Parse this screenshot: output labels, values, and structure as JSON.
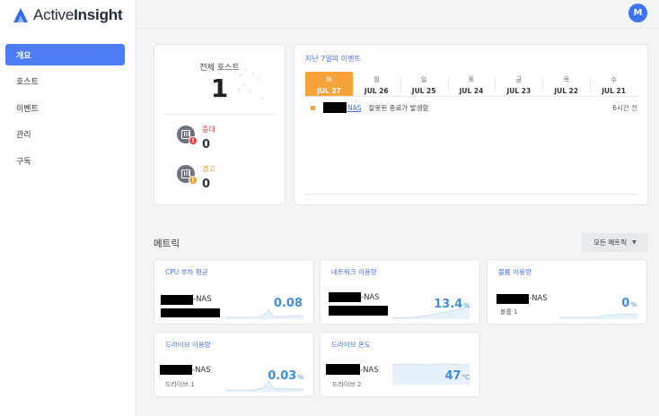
{
  "app": {
    "brand_light": "Active",
    "brand_bold": "Insight",
    "user_initial": "M"
  },
  "sidebar": {
    "items": [
      {
        "label": "개요",
        "active": true
      },
      {
        "label": "호스트",
        "active": false
      },
      {
        "label": "이벤트",
        "active": false
      },
      {
        "label": "관리",
        "active": false
      },
      {
        "label": "구독",
        "active": false
      }
    ]
  },
  "hosts": {
    "title": "전체 호스트",
    "count": "1",
    "critical": {
      "label": "중대",
      "value": "0",
      "color": "#e53e3e"
    },
    "warning": {
      "label": "경고",
      "value": "0",
      "color": "#f0a030"
    }
  },
  "events": {
    "title": "지난 7일의 이벤트",
    "days": [
      {
        "day": "화",
        "date": "JUL 27",
        "active": true
      },
      {
        "day": "월",
        "date": "JUL 26"
      },
      {
        "day": "일",
        "date": "JUL 25"
      },
      {
        "day": "토",
        "date": "JUL 24"
      },
      {
        "day": "금",
        "date": "JUL 23"
      },
      {
        "day": "목",
        "date": "JUL 22"
      },
      {
        "day": "수",
        "date": "JUL 21"
      }
    ],
    "row": {
      "host": "NAS",
      "message": "잘못된 종료가 발생함",
      "time": "6시간 전"
    }
  },
  "metrics": {
    "title": "메트릭",
    "all_button": "모든 메트릭",
    "cards": [
      {
        "title": "CPU 부하 평균",
        "host": "-NAS",
        "value": "0.08",
        "unit": ""
      },
      {
        "title": "네트워크 이용량",
        "host": "-NAS",
        "value": "13.4",
        "unit": "%"
      },
      {
        "title": "볼륨 이용량",
        "host": "-NAS",
        "sub": "볼륨 1",
        "value": "0",
        "unit": "%"
      },
      {
        "title": "드라이브 이용량",
        "host": "-NAS",
        "sub": "드라이브 1",
        "value": "0.03",
        "unit": "%"
      },
      {
        "title": "드라이브 온도",
        "host": "-NAS",
        "sub": "드라이브 2",
        "value": "47",
        "unit": "°C"
      }
    ]
  },
  "colors": {
    "accent": "#3f72f0",
    "nav_active": "#4d7cf6",
    "today": "#f7a33a",
    "metric_value": "#3f8de0"
  }
}
